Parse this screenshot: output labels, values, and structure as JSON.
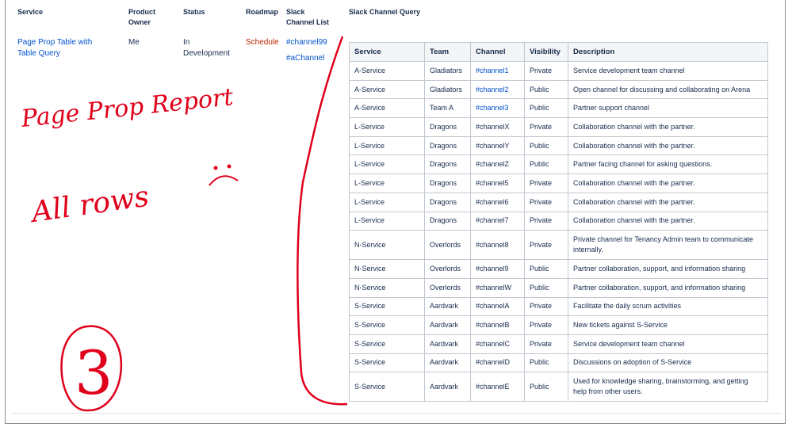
{
  "outer_headers": {
    "service": "Service",
    "product_owner": "Product Owner",
    "status": "Status",
    "roadmap": "Roadmap",
    "slack_channel_list": "Slack Channel List",
    "slack_channel_query": "Slack Channel Query"
  },
  "outer_row": {
    "service_link": "Page Prop Table with Table Query",
    "product_owner": "Me",
    "status": "In Development",
    "roadmap": "Schedule",
    "channels": [
      "#channel99",
      "#aChannel"
    ]
  },
  "inner_table": {
    "headers": [
      "Service",
      "Team",
      "Channel",
      "Visibility",
      "Description"
    ],
    "rows": [
      {
        "service": "A-Service",
        "team": "Gladiators",
        "channel": "#channel1",
        "channel_link": true,
        "visibility": "Private",
        "description": "Service development team channel"
      },
      {
        "service": "A-Service",
        "team": "Gladiators",
        "channel": "#channel2",
        "channel_link": true,
        "visibility": "Public",
        "description": "Open channel for discussing and collaborating on Arena"
      },
      {
        "service": "A-Service",
        "team": "Team A",
        "channel": "#channel3",
        "channel_link": true,
        "visibility": "Public",
        "description": "Partner support channel"
      },
      {
        "service": "L-Service",
        "team": "Dragons",
        "channel": "#channelX",
        "channel_link": false,
        "visibility": "Private",
        "description": "Collaboration channel with the partner."
      },
      {
        "service": "L-Service",
        "team": "Dragons",
        "channel": "#channelY",
        "channel_link": false,
        "visibility": "Public",
        "description": "Collaboration channel with the partner."
      },
      {
        "service": "L-Service",
        "team": "Dragons",
        "channel": "#channelZ",
        "channel_link": false,
        "visibility": "Public",
        "description": "Partner facing channel for asking questions."
      },
      {
        "service": "L-Service",
        "team": "Dragons",
        "channel": "#channel5",
        "channel_link": false,
        "visibility": "Private",
        "description": "Collaboration channel with the partner."
      },
      {
        "service": "L-Service",
        "team": "Dragons",
        "channel": "#channel6",
        "channel_link": false,
        "visibility": "Private",
        "description": "Collaboration channel with the partner."
      },
      {
        "service": "L-Service",
        "team": "Dragons",
        "channel": "#channel7",
        "channel_link": false,
        "visibility": "Private",
        "description": "Collaboration channel with the partner."
      },
      {
        "service": "N-Service",
        "team": "Overlords",
        "channel": "#channel8",
        "channel_link": false,
        "visibility": "Private",
        "description": "Private channel for Tenancy Admin team to communicate internally."
      },
      {
        "service": "N-Service",
        "team": "Overlords",
        "channel": "#channel9",
        "channel_link": false,
        "visibility": "Public",
        "description": "Partner collaboration, support, and information sharing"
      },
      {
        "service": "N-Service",
        "team": "Overlords",
        "channel": "#channelW",
        "channel_link": false,
        "visibility": "Public",
        "description": "Partner collaboration, support, and information sharing"
      },
      {
        "service": "S-Service",
        "team": "Aardvark",
        "channel": "#channelA",
        "channel_link": false,
        "visibility": "Private",
        "description": "Facilitate the daily scrum activities"
      },
      {
        "service": "S-Service",
        "team": "Aardvark",
        "channel": "#channelB",
        "channel_link": false,
        "visibility": "Private",
        "description": "New tickets against S-Service"
      },
      {
        "service": "S-Service",
        "team": "Aardvark",
        "channel": "#channelC",
        "channel_link": false,
        "visibility": "Private",
        "description": "Service development team channel"
      },
      {
        "service": "S-Service",
        "team": "Aardvark",
        "channel": "#channelD",
        "channel_link": false,
        "visibility": "Public",
        "description": "Discussions on adoption of S-Service"
      },
      {
        "service": "S-Service",
        "team": "Aardvark",
        "channel": "#channelE",
        "channel_link": false,
        "visibility": "Public",
        "description": "Used for knowledge sharing, brainstorming, and getting help from other users."
      }
    ]
  },
  "annotations": {
    "line1": "Page Prop Report",
    "line2": "All rows",
    "number": "3",
    "color": "#e0001a"
  },
  "colors": {
    "link": "#0052cc",
    "roadmap": "#bf2600",
    "text": "#172b4d",
    "header_bg": "#f4f5f7"
  }
}
